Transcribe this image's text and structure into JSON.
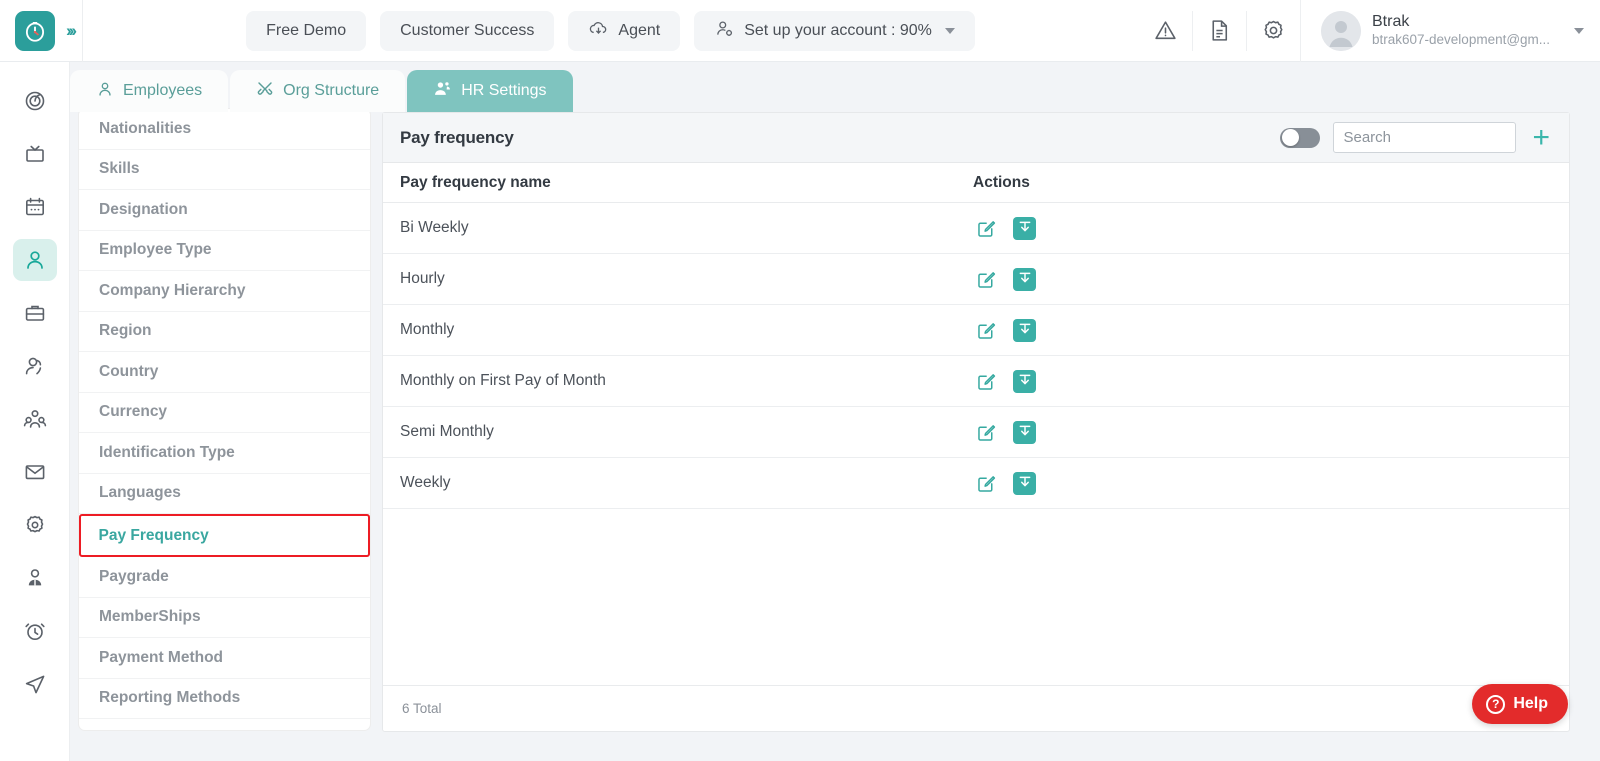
{
  "brand": {
    "accent": "#2b9e9b",
    "tab_active_bg": "#7fc4bf",
    "highlight_red": "#ed1c24",
    "help_red": "#e32b2b"
  },
  "topbar": {
    "logo_icon": "clock-logo-icon",
    "expand_icon": "chevron-double-right-icon",
    "pills": [
      {
        "label": "Free Demo",
        "icon": null
      },
      {
        "label": "Customer Success",
        "icon": null
      },
      {
        "label": "Agent",
        "icon": "cloud-download-icon"
      },
      {
        "label": "Set up your account : 90%",
        "icon": "user-setup-icon",
        "caret": true
      }
    ],
    "icons": [
      {
        "name": "warning-triangle-icon"
      },
      {
        "name": "document-icon"
      },
      {
        "name": "gear-icon"
      }
    ],
    "user": {
      "name": "Btrak",
      "email": "btrak607-development@gm...",
      "avatar_icon": "avatar-placeholder-icon",
      "caret_icon": "chevron-down-icon"
    }
  },
  "rail": {
    "items": [
      {
        "icon": "target-icon",
        "active": false
      },
      {
        "icon": "tv-icon",
        "active": false
      },
      {
        "icon": "calendar-icon",
        "active": false
      },
      {
        "icon": "person-icon",
        "active": true
      },
      {
        "icon": "briefcase-icon",
        "active": false
      },
      {
        "icon": "user-add-icon",
        "active": false
      },
      {
        "icon": "people-group-icon",
        "active": false
      },
      {
        "icon": "mail-icon",
        "active": false
      },
      {
        "icon": "gear-icon",
        "active": false
      },
      {
        "icon": "user-tie-icon",
        "active": false
      },
      {
        "icon": "alarm-clock-icon",
        "active": false
      },
      {
        "icon": "send-icon",
        "active": false
      }
    ]
  },
  "tabs": [
    {
      "label": "Employees",
      "icon": "person-icon",
      "active": false
    },
    {
      "label": "Org Structure",
      "icon": "tools-icon",
      "active": false
    },
    {
      "label": "HR Settings",
      "icon": "people-icon",
      "active": true
    }
  ],
  "sidebar": {
    "items": [
      {
        "label": "Nationalities",
        "selected": false
      },
      {
        "label": "Skills",
        "selected": false
      },
      {
        "label": "Designation",
        "selected": false
      },
      {
        "label": "Employee Type",
        "selected": false
      },
      {
        "label": "Company Hierarchy",
        "selected": false
      },
      {
        "label": "Region",
        "selected": false
      },
      {
        "label": "Country",
        "selected": false
      },
      {
        "label": "Currency",
        "selected": false
      },
      {
        "label": "Identification Type",
        "selected": false
      },
      {
        "label": "Languages",
        "selected": false
      },
      {
        "label": "Pay Frequency",
        "selected": true
      },
      {
        "label": "Paygrade",
        "selected": false
      },
      {
        "label": "MemberShips",
        "selected": false
      },
      {
        "label": "Payment Method",
        "selected": false
      },
      {
        "label": "Reporting Methods",
        "selected": false
      }
    ]
  },
  "main": {
    "title": "Pay frequency",
    "toggle": {
      "state": "off"
    },
    "search": {
      "value": "",
      "placeholder": "Search"
    },
    "add_button": {
      "icon": "plus-icon",
      "label": "+"
    },
    "columns": [
      "Pay frequency name",
      "Actions"
    ],
    "rows": [
      {
        "name": "Bi Weekly"
      },
      {
        "name": "Hourly"
      },
      {
        "name": "Monthly"
      },
      {
        "name": "Monthly on First Pay of Month"
      },
      {
        "name": "Semi Monthly"
      },
      {
        "name": "Weekly"
      }
    ],
    "row_actions": [
      {
        "icon": "edit-icon"
      },
      {
        "icon": "archive-download-icon"
      }
    ],
    "footer_total": "6 Total"
  },
  "help": {
    "label": "Help",
    "icon": "question-mark-icon"
  }
}
